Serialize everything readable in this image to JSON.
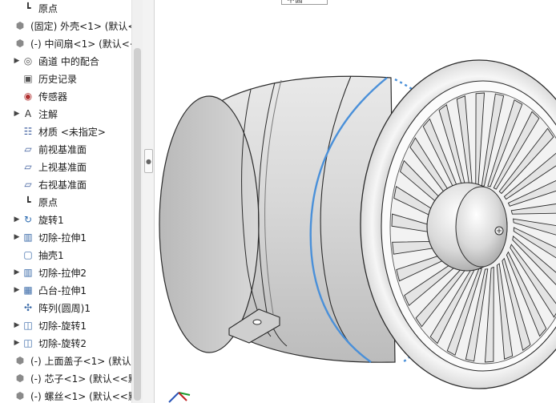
{
  "feature_tree": {
    "items": [
      {
        "label": "原点",
        "icon": "origin-icon",
        "expandable": false,
        "indent": 1
      },
      {
        "label": "(固定) 外壳<1> (默认<",
        "icon": "part-icon",
        "expandable": false,
        "indent": 0
      },
      {
        "label": "(-) 中间扇<1> (默认<<",
        "icon": "part-icon",
        "expandable": false,
        "indent": 0
      },
      {
        "label": "函道 中的配合",
        "icon": "mates-icon",
        "expandable": true,
        "indent": 1
      },
      {
        "label": "历史记录",
        "icon": "history-icon",
        "expandable": false,
        "indent": 1
      },
      {
        "label": "传感器",
        "icon": "sensor-icon",
        "expandable": false,
        "indent": 1
      },
      {
        "label": "注解",
        "icon": "annotation-icon",
        "expandable": true,
        "indent": 1
      },
      {
        "label": "材质 <未指定>",
        "icon": "material-icon",
        "expandable": false,
        "indent": 1
      },
      {
        "label": "前视基准面",
        "icon": "plane-icon",
        "expandable": false,
        "indent": 1
      },
      {
        "label": "上视基准面",
        "icon": "plane-icon",
        "expandable": false,
        "indent": 1
      },
      {
        "label": "右视基准面",
        "icon": "plane-icon",
        "expandable": false,
        "indent": 1
      },
      {
        "label": "原点",
        "icon": "origin-icon",
        "expandable": false,
        "indent": 1
      },
      {
        "label": "旋转1",
        "icon": "revolve-icon",
        "expandable": true,
        "indent": 1
      },
      {
        "label": "切除-拉伸1",
        "icon": "cut-extrude-icon",
        "expandable": true,
        "indent": 1
      },
      {
        "label": "抽壳1",
        "icon": "shell-icon",
        "expandable": false,
        "indent": 1
      },
      {
        "label": "切除-拉伸2",
        "icon": "cut-extrude-icon",
        "expandable": true,
        "indent": 1
      },
      {
        "label": "凸台-拉伸1",
        "icon": "boss-extrude-icon",
        "expandable": true,
        "indent": 1
      },
      {
        "label": "阵列(圆周)1",
        "icon": "circular-pattern-icon",
        "expandable": false,
        "indent": 1
      },
      {
        "label": "切除-旋转1",
        "icon": "cut-revolve-icon",
        "expandable": true,
        "indent": 1
      },
      {
        "label": "切除-旋转2",
        "icon": "cut-revolve-icon",
        "expandable": true,
        "indent": 1
      },
      {
        "label": "(-) 上面盖子<1> (默认<",
        "icon": "part-icon",
        "expandable": false,
        "indent": 0
      },
      {
        "label": "(-) 芯子<1> (默认<<默",
        "icon": "part-icon",
        "expandable": false,
        "indent": 0
      },
      {
        "label": "(-) 螺丝<1> (默认<<默",
        "icon": "part-icon",
        "expandable": false,
        "indent": 0
      }
    ]
  },
  "viewport": {
    "top_tab_label": "中面",
    "blade_count": 30,
    "colors": {
      "selection_blue": "#4a90d9",
      "body_gray": "#d4d4d4",
      "edge": "#2b2b2b"
    }
  }
}
